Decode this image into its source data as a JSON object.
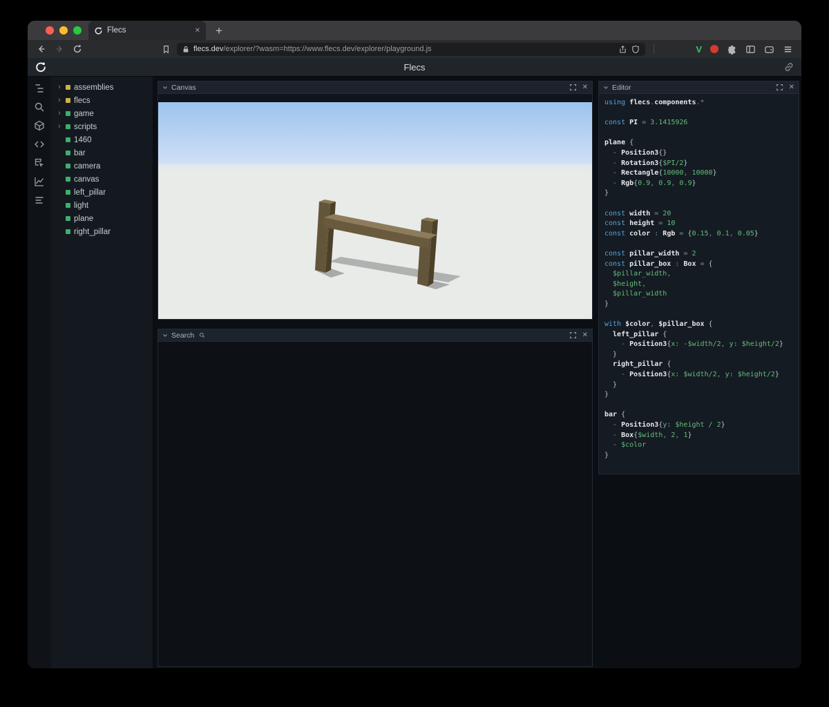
{
  "glyphs": {
    "close": "✕",
    "plus": "+",
    "tree_arrow": "›"
  },
  "browser": {
    "tab_title": "Flecs",
    "url_host": "flecs.dev",
    "url_rest": "/explorer/?wasm=https://www.flecs.dev/explorer/playground.js"
  },
  "extensions": {
    "v_label": "V"
  },
  "app": {
    "title": "Flecs"
  },
  "rail": {
    "icons": [
      "entity-tree-icon",
      "search-icon",
      "cube-icon",
      "code-icon",
      "inspect-icon",
      "chart-icon",
      "stats-icon"
    ]
  },
  "tree": {
    "items": [
      {
        "label": "assemblies",
        "color": "#cfb143",
        "expandable": true
      },
      {
        "label": "flecs",
        "color": "#cfb143",
        "expandable": true
      },
      {
        "label": "game",
        "color": "#3fae6e",
        "expandable": true
      },
      {
        "label": "scripts",
        "color": "#3fae6e",
        "expandable": true
      },
      {
        "label": "1460",
        "color": "#3fae6e",
        "expandable": false
      },
      {
        "label": "bar",
        "color": "#3fae6e",
        "expandable": false
      },
      {
        "label": "camera",
        "color": "#3fae6e",
        "expandable": false
      },
      {
        "label": "canvas",
        "color": "#3fae6e",
        "expandable": false
      },
      {
        "label": "left_pillar",
        "color": "#3fae6e",
        "expandable": false
      },
      {
        "label": "light",
        "color": "#3fae6e",
        "expandable": false
      },
      {
        "label": "plane",
        "color": "#3fae6e",
        "expandable": false
      },
      {
        "label": "right_pillar",
        "color": "#3fae6e",
        "expandable": false
      }
    ]
  },
  "panels": {
    "canvas": {
      "title": "Canvas"
    },
    "search": {
      "title": "Search",
      "icon": "magnifier"
    },
    "editor": {
      "title": "Editor",
      "code": [
        [
          [
            "k",
            "using "
          ],
          [
            "i",
            "flecs"
          ],
          [
            "p",
            "."
          ],
          [
            "i",
            "components"
          ],
          [
            "p",
            ".*"
          ]
        ],
        [],
        [
          [
            "k",
            "const "
          ],
          [
            "i",
            "PI"
          ],
          [
            "p",
            " = "
          ],
          [
            "v",
            "3.1415926"
          ]
        ],
        [],
        [
          [
            "i",
            "plane"
          ],
          [
            "t",
            " {"
          ]
        ],
        [
          [
            "p",
            "  - "
          ],
          [
            "i",
            "Position3"
          ],
          [
            "t",
            "{}"
          ]
        ],
        [
          [
            "p",
            "  - "
          ],
          [
            "i",
            "Rotation3"
          ],
          [
            "t",
            "{"
          ],
          [
            "v",
            "$PI/2"
          ],
          [
            "t",
            "}"
          ]
        ],
        [
          [
            "p",
            "  - "
          ],
          [
            "i",
            "Rectangle"
          ],
          [
            "t",
            "{"
          ],
          [
            "v",
            "10000"
          ],
          [
            "p",
            ", "
          ],
          [
            "v",
            "10000"
          ],
          [
            "t",
            "}"
          ]
        ],
        [
          [
            "p",
            "  - "
          ],
          [
            "i",
            "Rgb"
          ],
          [
            "t",
            "{"
          ],
          [
            "v",
            "0.9"
          ],
          [
            "p",
            ", "
          ],
          [
            "v",
            "0.9"
          ],
          [
            "p",
            ", "
          ],
          [
            "v",
            "0.9"
          ],
          [
            "t",
            "}"
          ]
        ],
        [
          [
            "t",
            "}"
          ]
        ],
        [],
        [
          [
            "k",
            "const "
          ],
          [
            "i",
            "width"
          ],
          [
            "p",
            " = "
          ],
          [
            "v",
            "20"
          ]
        ],
        [
          [
            "k",
            "const "
          ],
          [
            "i",
            "height"
          ],
          [
            "p",
            " = "
          ],
          [
            "v",
            "10"
          ]
        ],
        [
          [
            "k",
            "const "
          ],
          [
            "i",
            "color"
          ],
          [
            "p",
            " : "
          ],
          [
            "i",
            "Rgb"
          ],
          [
            "p",
            " = "
          ],
          [
            "t",
            "{"
          ],
          [
            "v",
            "0.15"
          ],
          [
            "p",
            ", "
          ],
          [
            "v",
            "0.1"
          ],
          [
            "p",
            ", "
          ],
          [
            "v",
            "0.05"
          ],
          [
            "t",
            "}"
          ]
        ],
        [],
        [
          [
            "k",
            "const "
          ],
          [
            "i",
            "pillar_width"
          ],
          [
            "p",
            " = "
          ],
          [
            "v",
            "2"
          ]
        ],
        [
          [
            "k",
            "const "
          ],
          [
            "i",
            "pillar_box"
          ],
          [
            "p",
            " : "
          ],
          [
            "i",
            "Box"
          ],
          [
            "p",
            " = "
          ],
          [
            "t",
            "{"
          ]
        ],
        [
          [
            "v",
            "  $pillar_width"
          ],
          [
            "p",
            ","
          ]
        ],
        [
          [
            "v",
            "  $height"
          ],
          [
            "p",
            ","
          ]
        ],
        [
          [
            "v",
            "  $pillar_width"
          ]
        ],
        [
          [
            "t",
            "}"
          ]
        ],
        [],
        [
          [
            "k",
            "with "
          ],
          [
            "i",
            "$color"
          ],
          [
            "p",
            ", "
          ],
          [
            "i",
            "$pillar_box"
          ],
          [
            "t",
            " {"
          ]
        ],
        [
          [
            "i",
            "  left_pillar"
          ],
          [
            "t",
            " {"
          ]
        ],
        [
          [
            "p",
            "    - "
          ],
          [
            "i",
            "Position3"
          ],
          [
            "t",
            "{"
          ],
          [
            "v",
            "x:"
          ],
          [
            "t",
            " "
          ],
          [
            "v",
            "-$width/2"
          ],
          [
            "p",
            ", "
          ],
          [
            "v",
            "y:"
          ],
          [
            "t",
            " "
          ],
          [
            "v",
            "$height/2"
          ],
          [
            "t",
            "}"
          ]
        ],
        [
          [
            "t",
            "  }"
          ]
        ],
        [
          [
            "i",
            "  right_pillar"
          ],
          [
            "t",
            " {"
          ]
        ],
        [
          [
            "p",
            "    - "
          ],
          [
            "i",
            "Position3"
          ],
          [
            "t",
            "{"
          ],
          [
            "v",
            "x:"
          ],
          [
            "t",
            " "
          ],
          [
            "v",
            "$width/2"
          ],
          [
            "p",
            ", "
          ],
          [
            "v",
            "y:"
          ],
          [
            "t",
            " "
          ],
          [
            "v",
            "$height/2"
          ],
          [
            "t",
            "}"
          ]
        ],
        [
          [
            "t",
            "  }"
          ]
        ],
        [
          [
            "t",
            "}"
          ]
        ],
        [],
        [
          [
            "i",
            "bar"
          ],
          [
            "t",
            " {"
          ]
        ],
        [
          [
            "p",
            "  - "
          ],
          [
            "i",
            "Position3"
          ],
          [
            "t",
            "{"
          ],
          [
            "v",
            "y:"
          ],
          [
            "t",
            " "
          ],
          [
            "v",
            "$height / 2"
          ],
          [
            "t",
            "}"
          ]
        ],
        [
          [
            "p",
            "  - "
          ],
          [
            "i",
            "Box"
          ],
          [
            "t",
            "{"
          ],
          [
            "v",
            "$width"
          ],
          [
            "p",
            ", "
          ],
          [
            "v",
            "2"
          ],
          [
            "p",
            ", "
          ],
          [
            "v",
            "1"
          ],
          [
            "t",
            "}"
          ]
        ],
        [
          [
            "p",
            "  - "
          ],
          [
            "v",
            "$color"
          ]
        ],
        [
          [
            "t",
            "}"
          ]
        ]
      ]
    }
  },
  "scene": {
    "sky_top": "#9cc3ed",
    "sky_bottom": "#cfe0f6",
    "ground": "#e9ebe9",
    "wood_front": "#63553a",
    "wood_side": "#4c4028",
    "wood_top": "#8a7856",
    "bar_front": "#6a5a3d",
    "bar_top": "#8d7c5b"
  }
}
